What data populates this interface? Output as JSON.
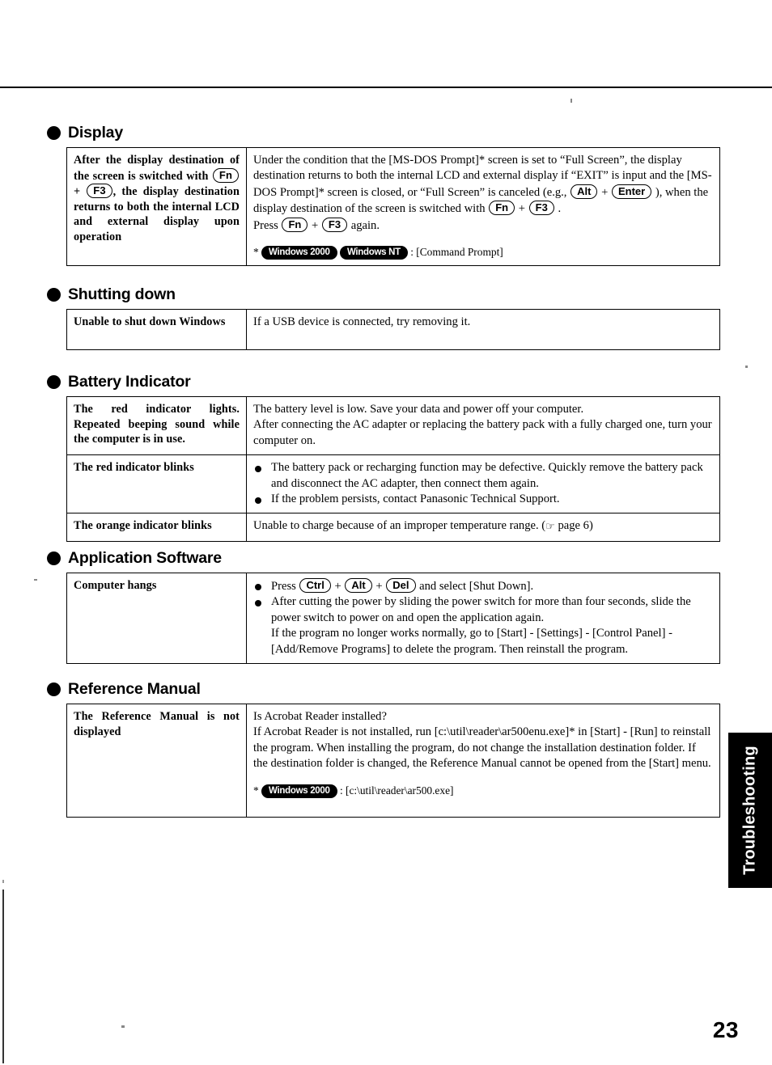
{
  "page": {
    "number": "23",
    "side_tab": "Troubleshooting"
  },
  "sections": [
    {
      "heading": "Display",
      "rows": [
        {
          "symptom_parts": [
            {
              "t": "text",
              "v": "After the display destination of the screen is switched with "
            },
            {
              "t": "key",
              "v": "Fn"
            },
            {
              "t": "text",
              "v": " + "
            },
            {
              "t": "key",
              "v": "F3"
            },
            {
              "t": "text",
              "v": ", the display destination returns to both the internal LCD and external display upon operation"
            }
          ],
          "symptom_plain": "After the display destination of the screen is switched with Fn + F3, the display destination returns to both the internal LCD and external display upon operation",
          "desc_parts": [
            {
              "t": "text",
              "v": "Under the condition that the [MS-DOS Prompt]* screen is set to “Full Screen”, the display destination returns to both the internal LCD and external display if “EXIT” is input and the [MS-DOS Prompt]* screen is closed, or “Full Screen” is canceled (e.g., "
            },
            {
              "t": "key",
              "v": "Alt"
            },
            {
              "t": "text",
              "v": " + "
            },
            {
              "t": "key",
              "v": "Enter"
            },
            {
              "t": "text",
              "v": " ), when the display destination of the screen is switched with "
            },
            {
              "t": "key",
              "v": "Fn"
            },
            {
              "t": "text",
              "v": " + "
            },
            {
              "t": "key",
              "v": "F3"
            },
            {
              "t": "text",
              "v": " ."
            },
            {
              "t": "br"
            },
            {
              "t": "text",
              "v": "Press "
            },
            {
              "t": "key",
              "v": "Fn"
            },
            {
              "t": "text",
              "v": " + "
            },
            {
              "t": "key",
              "v": "F3"
            },
            {
              "t": "text",
              "v": " again."
            }
          ],
          "footnote_parts": [
            {
              "t": "text",
              "v": "* "
            },
            {
              "t": "badge",
              "v": "Windows 2000"
            },
            {
              "t": "text",
              "v": " "
            },
            {
              "t": "badge",
              "v": "Windows NT"
            },
            {
              "t": "text",
              "v": " : [Command Prompt]"
            }
          ]
        }
      ]
    },
    {
      "heading": "Shutting down",
      "rows": [
        {
          "symptom_parts": [
            {
              "t": "text",
              "v": "Unable to shut down Windows"
            }
          ],
          "symptom_plain": "Unable to shut down Windows",
          "desc_parts": [
            {
              "t": "text",
              "v": "If a USB device is connected, try removing it."
            }
          ]
        }
      ]
    },
    {
      "heading": "Battery Indicator",
      "rows": [
        {
          "symptom_parts": [
            {
              "t": "text",
              "v": "The red indicator lights. Repeated beeping sound while the computer is in use."
            }
          ],
          "symptom_plain": "The red indicator lights. Repeated beeping sound while the computer is in use.",
          "desc_parts": [
            {
              "t": "text",
              "v": "The battery level is low.  Save your data and power off your computer."
            },
            {
              "t": "br"
            },
            {
              "t": "text",
              "v": "After connecting the AC adapter or replacing the battery pack with a fully charged one, turn your computer on."
            }
          ]
        },
        {
          "symptom_parts": [
            {
              "t": "text",
              "v": "The red indicator blinks"
            }
          ],
          "symptom_plain": "The red indicator blinks",
          "desc_bullets": [
            "The battery pack or recharging function may be defective.  Quickly remove the battery pack and disconnect the AC adapter, then connect them again.",
            "If the problem persists, contact Panasonic Technical Support."
          ]
        },
        {
          "symptom_parts": [
            {
              "t": "text",
              "v": "The orange indicator blinks"
            }
          ],
          "symptom_plain": "The orange indicator blinks",
          "desc_parts": [
            {
              "t": "text",
              "v": "Unable to charge because of an improper temperature range. ("
            },
            {
              "t": "hand",
              "v": "☞"
            },
            {
              "t": "text",
              "v": " page 6)"
            }
          ]
        }
      ]
    },
    {
      "heading": "Application Software",
      "rows": [
        {
          "symptom_parts": [
            {
              "t": "text",
              "v": "Computer hangs"
            }
          ],
          "symptom_plain": "Computer hangs",
          "desc_bullet_parts": [
            [
              {
                "t": "text",
                "v": "Press "
              },
              {
                "t": "key",
                "v": "Ctrl"
              },
              {
                "t": "text",
                "v": " + "
              },
              {
                "t": "key",
                "v": "Alt"
              },
              {
                "t": "text",
                "v": " + "
              },
              {
                "t": "key",
                "v": "Del"
              },
              {
                "t": "text",
                "v": " and select [Shut Down]."
              }
            ],
            [
              {
                "t": "text",
                "v": "After cutting the power by sliding the power switch for more than four seconds, slide the power switch to power on and open the application again."
              },
              {
                "t": "br"
              },
              {
                "t": "text",
                "v": "If the program no longer works normally, go to [Start] - [Settings] - [Control Panel] - [Add/Remove Programs] to delete the program.  Then reinstall the program."
              }
            ]
          ]
        }
      ]
    },
    {
      "heading": "Reference Manual",
      "rows": [
        {
          "symptom_parts": [
            {
              "t": "text",
              "v": "The Reference Manual is not displayed"
            }
          ],
          "symptom_plain": "The Reference Manual is not displayed",
          "desc_parts": [
            {
              "t": "text",
              "v": "Is Acrobat Reader installed?"
            },
            {
              "t": "br"
            },
            {
              "t": "text",
              "v": "If Acrobat Reader is not installed, run [c:\\util\\reader\\ar500enu.exe]* in [Start] - [Run] to reinstall the program.  When installing the program, do not change the installation destination folder.  If the destination folder is changed, the Reference Manual cannot be opened from the [Start] menu."
            }
          ],
          "footnote_parts": [
            {
              "t": "text",
              "v": "* "
            },
            {
              "t": "badge",
              "v": "Windows 2000"
            },
            {
              "t": "text",
              "v": " : [c:\\util\\reader\\ar500.exe]"
            }
          ]
        }
      ]
    }
  ]
}
